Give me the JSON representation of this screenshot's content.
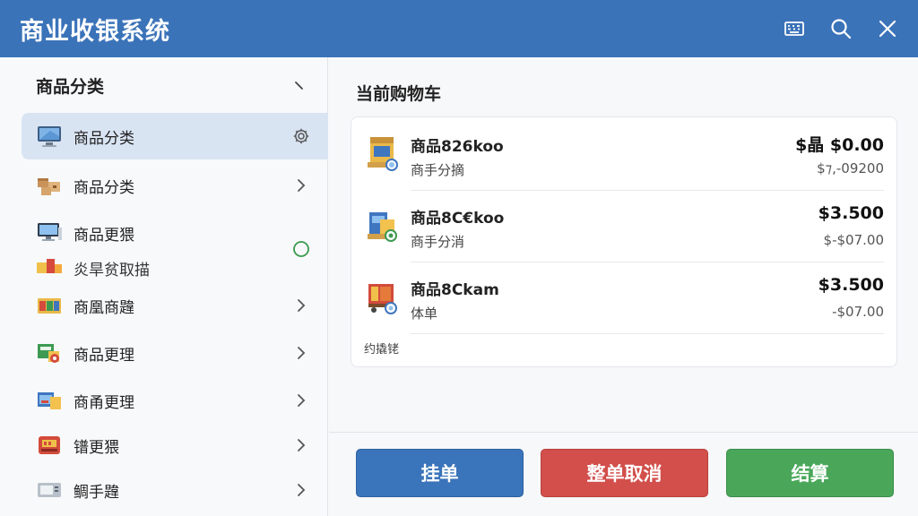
{
  "window": {
    "title": "商业收银系统",
    "icons": [
      "keyboard-icon",
      "search-icon",
      "close-icon"
    ]
  },
  "sidebar": {
    "title": "商品分类",
    "items": [
      {
        "label": "商品分类",
        "sublabel": "",
        "icon": "monitor-icon",
        "right": "gear-icon",
        "active": true
      },
      {
        "label": "商品分类",
        "sublabel": "",
        "icon": "boxes-icon",
        "right": "chevron-right-icon",
        "active": false
      },
      {
        "label": "商品更猥",
        "sublabel": "炎旱贫取描",
        "icon": "computer-icon",
        "right": "status-circle-icon",
        "active": false
      },
      {
        "label": "商凰商韙",
        "sublabel": "",
        "icon": "products-icon",
        "right": "chevron-right-icon",
        "active": false
      },
      {
        "label": "商品更理",
        "sublabel": "",
        "icon": "tag-icon",
        "right": "chevron-right-icon",
        "active": false
      },
      {
        "label": "商甬更理",
        "sublabel": "",
        "icon": "shelf-icon",
        "right": "chevron-right-icon",
        "active": false
      },
      {
        "label": "镨更猥",
        "sublabel": "",
        "icon": "register-icon",
        "right": "chevron-right-icon",
        "active": false
      },
      {
        "label": "鲷手韙",
        "sublabel": "",
        "icon": "scanner-icon",
        "right": "chevron-right-icon",
        "active": false
      }
    ]
  },
  "cart": {
    "title": "当前购物车",
    "items": [
      {
        "name": "商品826koo",
        "sub": "商手分摘",
        "price": "$晶 $0.00",
        "sub_price": "$⁊,-09200",
        "icon": "product-box-icon"
      },
      {
        "name": "商品8C€koo",
        "sub": "商手分消",
        "price": "$3.500",
        "sub_price": "$-$07.00",
        "icon": "product-pack-icon"
      },
      {
        "name": "商品8Ckam",
        "sub": "体单",
        "price": "$3.500",
        "sub_price": "-$07.00",
        "icon": "product-cart-icon"
      }
    ],
    "note": "约撬铑"
  },
  "actions": {
    "hold": "挂单",
    "cancel": "整单取消",
    "pay": "结算"
  },
  "colors": {
    "header": "#3b73b9",
    "active_item": "#d9e4f3",
    "hold_button": "#3a74ba",
    "cancel_button": "#d24f4b",
    "pay_button": "#4aa75a",
    "status_circle": "#3a9a4e"
  }
}
